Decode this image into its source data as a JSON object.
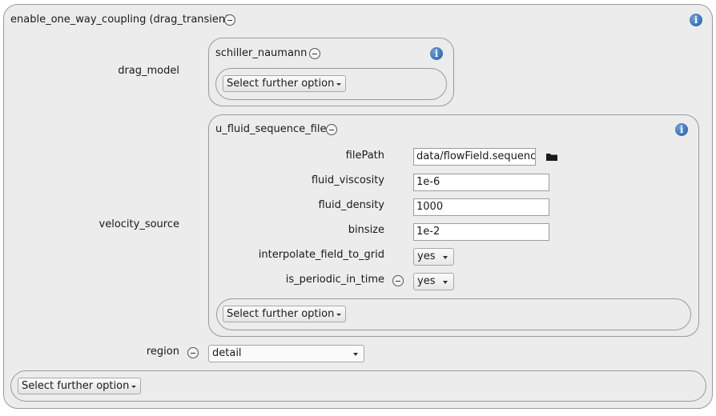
{
  "root": {
    "title": "enable_one_way_coupling (drag_transient)",
    "select_further_option": "Select further option"
  },
  "drag_model": {
    "label": "drag_model",
    "panel_title": "schiller_naumann",
    "select_further_option": "Select further option"
  },
  "velocity_source": {
    "label": "velocity_source",
    "panel_title": "u_fluid_sequence_file",
    "filePath": {
      "label": "filePath",
      "value": "data/flowField.sequence"
    },
    "fluid_viscosity": {
      "label": "fluid_viscosity",
      "value": "1e-6"
    },
    "fluid_density": {
      "label": "fluid_density",
      "value": "1000"
    },
    "binsize": {
      "label": "binsize",
      "value": "1e-2"
    },
    "interpolate_field_to_grid": {
      "label": "interpolate_field_to_grid",
      "value": "yes"
    },
    "is_periodic_in_time": {
      "label": "is_periodic_in_time",
      "value": "yes"
    },
    "select_further_option": "Select further option"
  },
  "region": {
    "label": "region",
    "value": "detail"
  },
  "icons": {
    "info": "i",
    "remove": "minus-circle-icon",
    "folder": "folder-icon",
    "dropdown": "caret-down-icon"
  },
  "colors": {
    "panel_bg": "#ececec",
    "border": "#9a9a9a",
    "info_blue": "#1f5aa8"
  }
}
